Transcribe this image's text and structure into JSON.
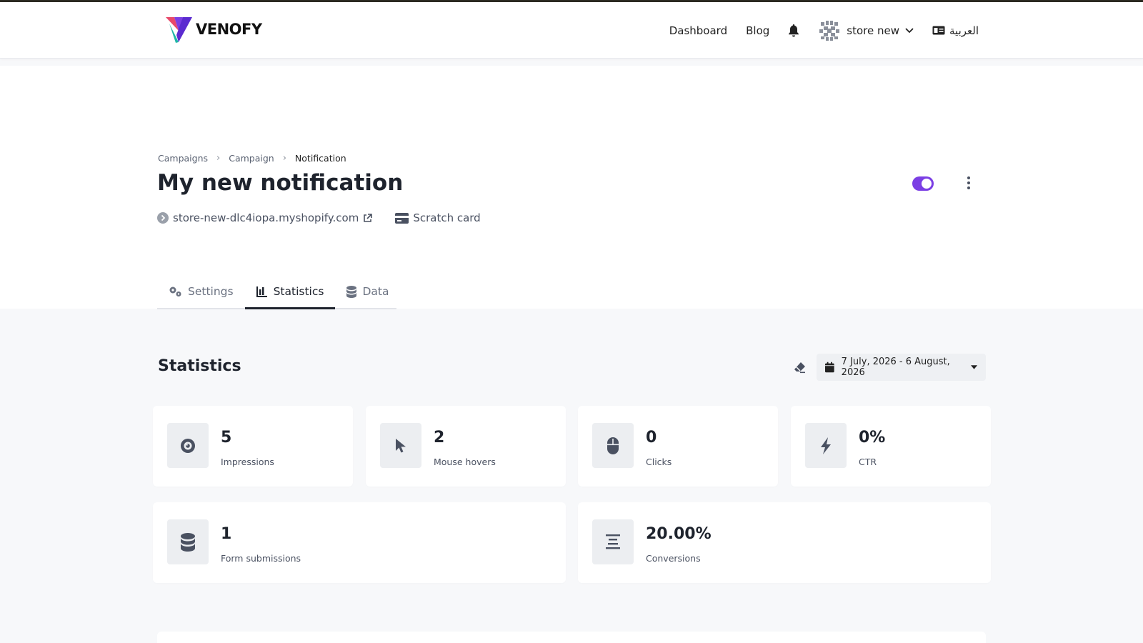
{
  "navbar": {
    "brand": "VENOFY",
    "links": {
      "dashboard": "Dashboard",
      "blog": "Blog"
    },
    "store_name": "store new",
    "language": "العربية"
  },
  "breadcrumb": [
    "Campaigns",
    "Campaign",
    "Notification"
  ],
  "page": {
    "title": "My new notification",
    "store_url": "store-new-dlc4iopa.myshopify.com",
    "campaign_type": "Scratch card",
    "active": true
  },
  "tabs": [
    {
      "label": "Settings",
      "icon": "gears-icon"
    },
    {
      "label": "Statistics",
      "icon": "chart-icon",
      "active": true
    },
    {
      "label": "Data",
      "icon": "database-icon"
    }
  ],
  "statistics": {
    "title": "Statistics",
    "date_range": "7 July, 2026 - 6 August, 2026",
    "cards": [
      {
        "value": "5",
        "label": "Impressions",
        "icon": "eye-icon"
      },
      {
        "value": "2",
        "label": "Mouse hovers",
        "icon": "pointer-icon"
      },
      {
        "value": "0",
        "label": "Clicks",
        "icon": "mouse-icon"
      },
      {
        "value": "0%",
        "label": "CTR",
        "icon": "bolt-icon"
      },
      {
        "value": "1",
        "label": "Form submissions",
        "icon": "database-icon"
      },
      {
        "value": "20.00%",
        "label": "Conversions",
        "icon": "funnel-icon"
      }
    ]
  },
  "colors": {
    "accent": "#7b3fe4",
    "icon_box": "#eceef1"
  }
}
